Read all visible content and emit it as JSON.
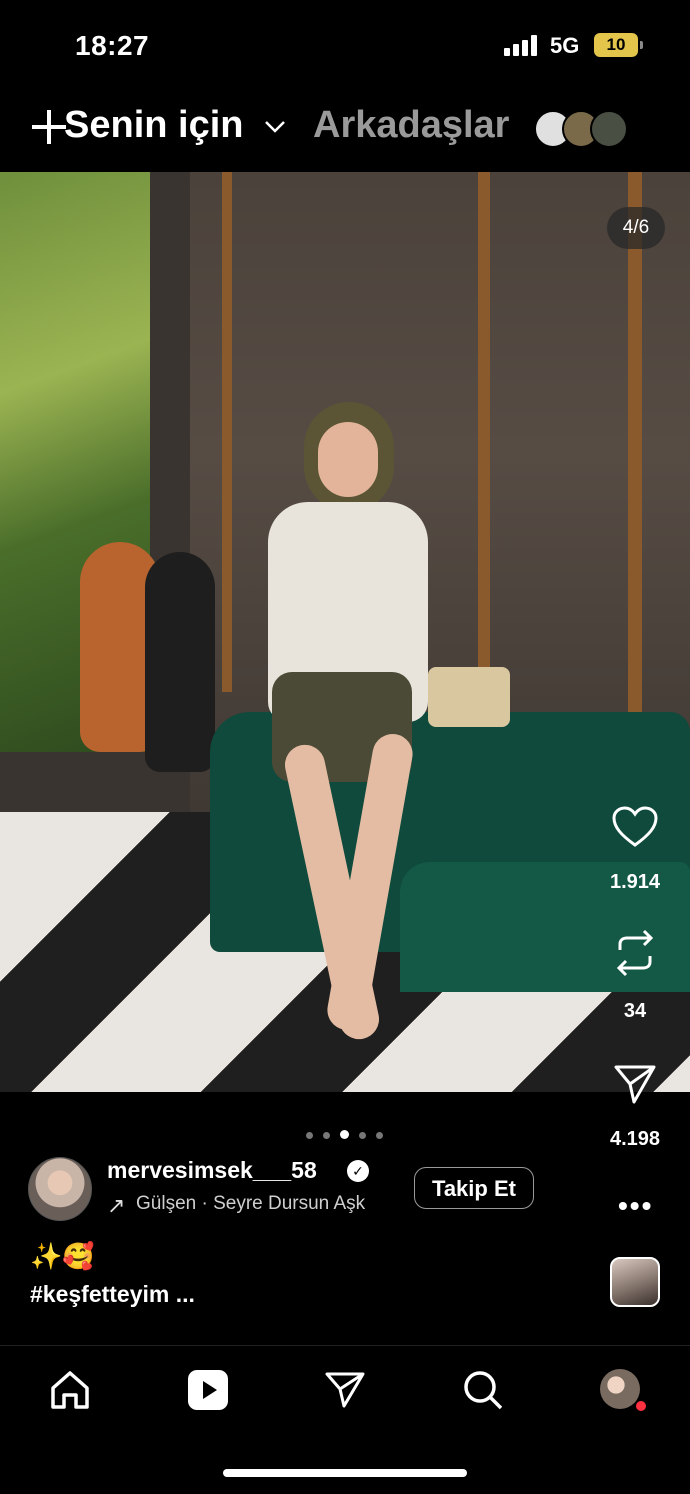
{
  "status_bar": {
    "time": "18:27",
    "network": "5G",
    "battery": "10"
  },
  "header": {
    "tab_for_you": "Senin için",
    "tab_friends": "Arkadaşlar"
  },
  "post": {
    "counter": "4/6",
    "likes": "1.914",
    "reposts": "34",
    "shares": "4.198",
    "username": "mervesimsek___58",
    "music": "Gülşen · Seyre Dursun Aşk",
    "follow_label": "Takip Et",
    "more": "•••",
    "caption_emojis": "✨🥰",
    "caption": "#keşfetteyim ...",
    "carousel_pages": 5,
    "carousel_active": 3
  },
  "colors": {
    "accent_battery": "#e2c54a",
    "notification_dot": "#ff3040"
  },
  "icons": [
    "plus-icon",
    "chevron-down-icon",
    "heart-icon",
    "repost-icon",
    "send-icon",
    "home-icon",
    "reels-icon",
    "direct-icon",
    "search-icon",
    "verified-icon",
    "music-arrow-icon"
  ]
}
